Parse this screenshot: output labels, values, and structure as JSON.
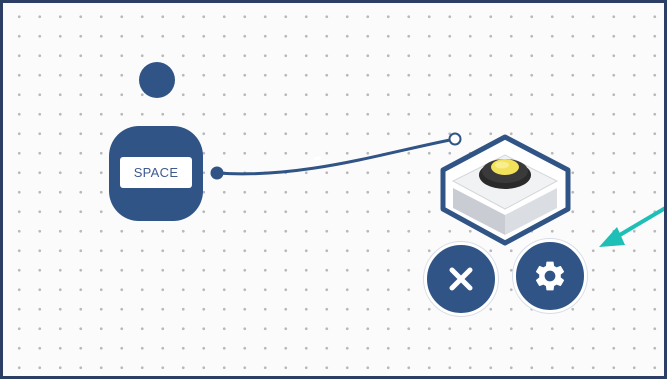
{
  "node": {
    "label": "SPACE"
  },
  "colors": {
    "node_fill": "#2f5485",
    "wire": "#2f5485",
    "canvas_dot": "#b9b9b9",
    "frame_border": "#2c3e63",
    "arrow": "#1dbfb6",
    "button_led": "#f2e15a"
  },
  "icons": {
    "delete": "close-x-icon",
    "settings": "gear-icon",
    "device": "push-button-device-icon",
    "pointer": "teal-arrow-icon"
  }
}
